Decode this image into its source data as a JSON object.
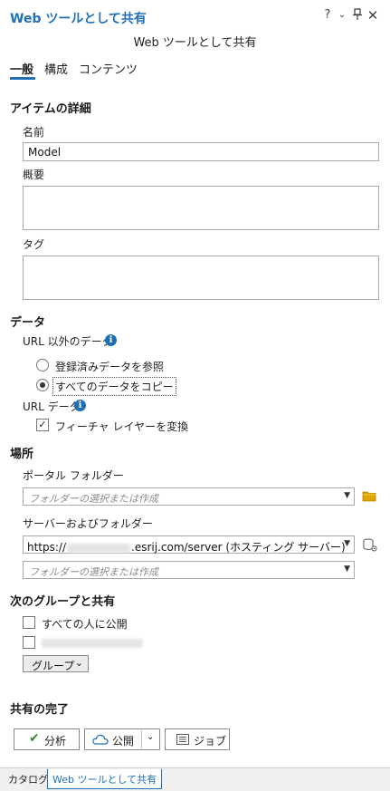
{
  "window": {
    "title": "Web ツールとして共有",
    "subtitle": "Web ツールとして共有"
  },
  "tabs": [
    {
      "label": "一般"
    },
    {
      "label": "構成"
    },
    {
      "label": "コンテンツ"
    }
  ],
  "item_details": {
    "heading": "アイテムの詳細",
    "name_label": "名前",
    "name_value": "Model",
    "summary_label": "概要",
    "tags_label": "タグ"
  },
  "data": {
    "heading": "データ",
    "non_url_label": "URL 以外のデータ",
    "radio_options": [
      {
        "label": "登録済みデータを参照",
        "selected": false
      },
      {
        "label": "すべてのデータをコピー",
        "selected": true
      }
    ],
    "url_label": "URL データ",
    "convert_feature_label": "フィーチャ レイヤーを変換",
    "convert_feature_checked": true
  },
  "location": {
    "heading": "場所",
    "portal_folder_label": "ポータル フォルダー",
    "portal_folder_placeholder": "フォルダーの選択または作成",
    "server_folder_label": "サーバーおよびフォルダー",
    "server_prefix": "https://",
    "server_suffix": ".esrij.com/server (ホスティング サーバー)",
    "server_folder_placeholder": "フォルダーの選択または作成"
  },
  "sharing": {
    "heading": "次のグループと共有",
    "everyone_label": "すべての人に公開",
    "group_dropdown_label": "グループ"
  },
  "finish": {
    "heading": "共有の完了",
    "analyze_label": "分析",
    "publish_label": "公開",
    "jobs_label": "ジョブ"
  },
  "bottom_tabs": [
    {
      "label": "カタログ"
    },
    {
      "label": "Web ツールとして共有"
    }
  ],
  "colors": {
    "accent": "#1e6fb5",
    "check_green": "#2e8b2e",
    "folder_yellow": "#e0a400"
  }
}
